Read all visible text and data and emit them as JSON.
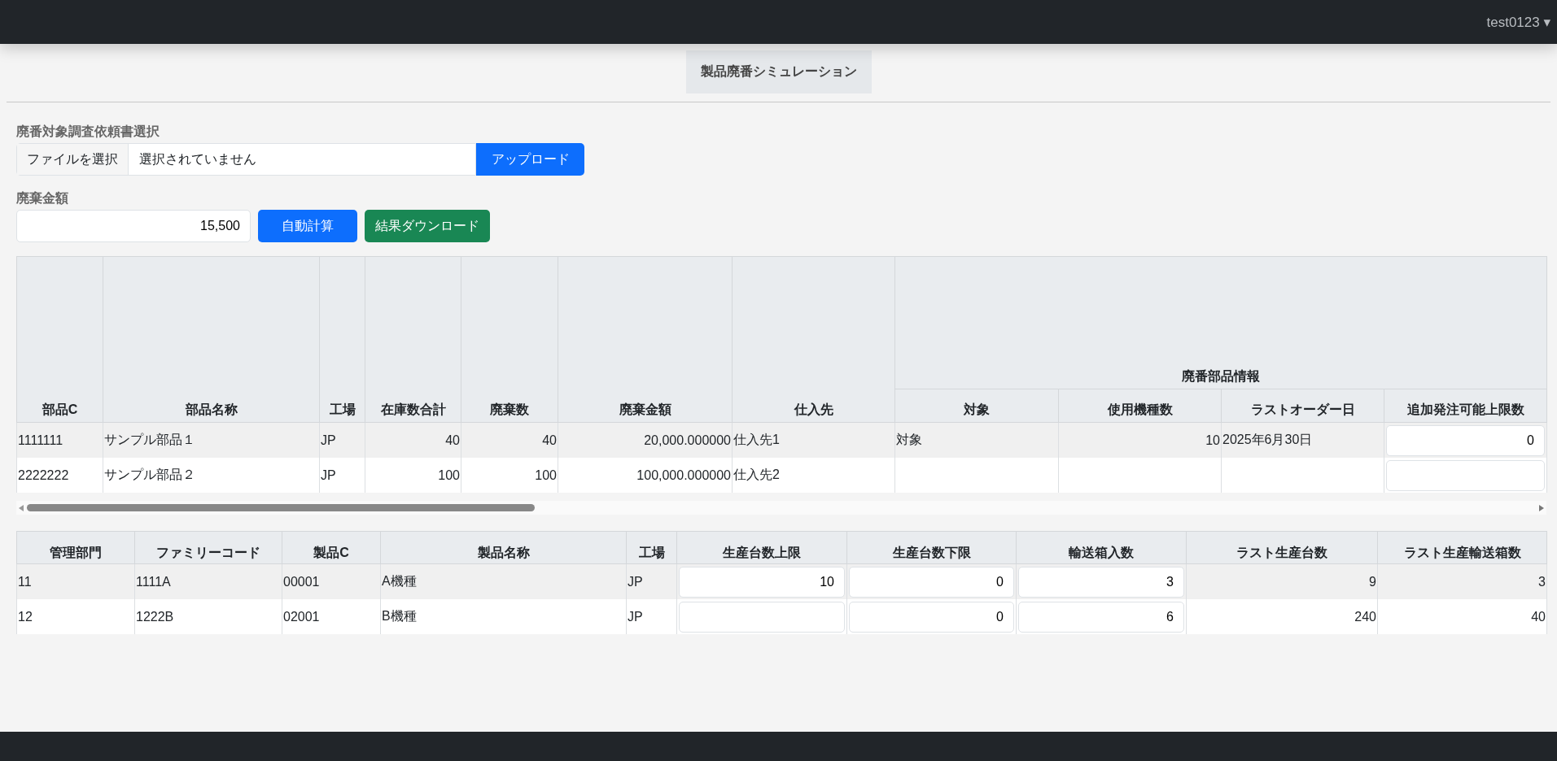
{
  "navbar": {
    "user": "test0123 ▾"
  },
  "page_title": "製品廃番シミュレーション",
  "upload": {
    "label": "廃番対象調査依頼書選択",
    "file_button": "ファイルを選択",
    "file_status": "選択されていません",
    "upload_button": "アップロード"
  },
  "amount": {
    "label": "廃棄金額",
    "value": "15,500",
    "calc_button": "自動計算",
    "download_button": "結果ダウンロード"
  },
  "parts_table": {
    "columns": [
      "部品C",
      "部品名称",
      "工場",
      "在庫数合計",
      "廃棄数",
      "廃棄金額",
      "仕入先"
    ],
    "group": {
      "label": "廃番部品情報",
      "columns": [
        "対象",
        "使用機種数",
        "ラストオーダー日",
        "追加発注可能上限数"
      ]
    },
    "rows": [
      [
        {
          "kind": "text",
          "text": "1111111"
        },
        {
          "kind": "text",
          "text": "サンプル部品１"
        },
        {
          "kind": "text",
          "text": "JP"
        },
        {
          "kind": "number",
          "text": "40"
        },
        {
          "kind": "number",
          "text": "40"
        },
        {
          "kind": "number",
          "text": "20,000.000000"
        },
        {
          "kind": "text",
          "text": "仕入先1"
        },
        {
          "kind": "text",
          "text": "対象"
        },
        {
          "kind": "number",
          "text": "10"
        },
        {
          "kind": "text",
          "text": "2025年6月30日"
        },
        {
          "kind": "input",
          "value": "0"
        }
      ],
      [
        {
          "kind": "text",
          "text": "2222222"
        },
        {
          "kind": "text",
          "text": "サンプル部品２"
        },
        {
          "kind": "text",
          "text": "JP"
        },
        {
          "kind": "number",
          "text": "100"
        },
        {
          "kind": "number",
          "text": "100"
        },
        {
          "kind": "number",
          "text": "100,000.000000"
        },
        {
          "kind": "text",
          "text": "仕入先2"
        },
        {
          "kind": "text"
        },
        {
          "kind": "number"
        },
        {
          "kind": "text"
        },
        {
          "kind": "input"
        }
      ]
    ]
  },
  "products_table": {
    "columns": [
      "管理部門",
      "ファミリーコード",
      "製品C",
      "製品名称",
      "工場",
      "生産台数上限",
      "生産台数下限",
      "輸送箱入数",
      "ラスト生産台数",
      "ラスト生産輸送箱数"
    ],
    "rows": [
      [
        {
          "kind": "text",
          "text": "11"
        },
        {
          "kind": "text",
          "text": "1111A"
        },
        {
          "kind": "text",
          "text": "00001"
        },
        {
          "kind": "text",
          "text": "A機種"
        },
        {
          "kind": "text",
          "text": "JP"
        },
        {
          "kind": "input",
          "value": "10"
        },
        {
          "kind": "input",
          "value": "0"
        },
        {
          "kind": "input",
          "value": "3"
        },
        {
          "kind": "number",
          "text": "9"
        },
        {
          "kind": "number",
          "text": "3"
        }
      ],
      [
        {
          "kind": "text",
          "text": "12"
        },
        {
          "kind": "text",
          "text": "1222B"
        },
        {
          "kind": "text",
          "text": "02001"
        },
        {
          "kind": "text",
          "text": "B機種"
        },
        {
          "kind": "text",
          "text": "JP"
        },
        {
          "kind": "input"
        },
        {
          "kind": "input",
          "value": "0"
        },
        {
          "kind": "input",
          "value": "6"
        },
        {
          "kind": "number",
          "text": "240"
        },
        {
          "kind": "number",
          "text": "40"
        }
      ]
    ]
  }
}
